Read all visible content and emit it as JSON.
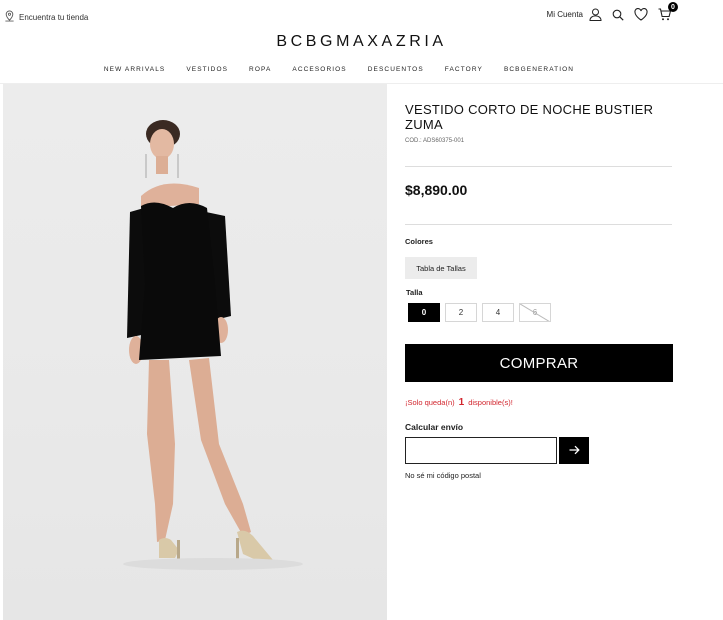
{
  "header": {
    "store_link": "Encuentra tu tienda",
    "account_label": "Mi Cuenta",
    "cart_count": "0",
    "logo": "BCBGMAXAZRIA",
    "nav": [
      "NEW ARRIVALS",
      "VESTIDOS",
      "ROPA",
      "ACCESORIOS",
      "DESCUENTOS",
      "FACTORY",
      "BCBGENERATION"
    ],
    "icons": [
      "location-pin-icon",
      "user-icon",
      "search-icon",
      "heart-icon",
      "cart-icon"
    ]
  },
  "product": {
    "title": "VESTIDO CORTO DE NOCHE BUSTIER ZUMA",
    "sku": "COD.: ADS60375-001",
    "price": "$8,890.00",
    "colors_label": "Colores",
    "size_chart_label": "Tabla de Tallas",
    "size_label": "Talla",
    "sizes": [
      {
        "label": "0",
        "state": "selected"
      },
      {
        "label": "2",
        "state": "available"
      },
      {
        "label": "4",
        "state": "available"
      },
      {
        "label": "6",
        "state": "unavailable"
      }
    ],
    "buy_label": "COMPRAR",
    "stock_prefix": "¡Solo queda(n)",
    "stock_qty": "1",
    "stock_suffix": "disponible(s)!"
  },
  "shipping": {
    "label": "Calcular envío",
    "zip_value": "",
    "no_zip_link": "No sé mi código postal"
  },
  "colors": {
    "accent": "#000000",
    "stock_alert": "#d2262e",
    "image_background": "#e9e9e9"
  }
}
